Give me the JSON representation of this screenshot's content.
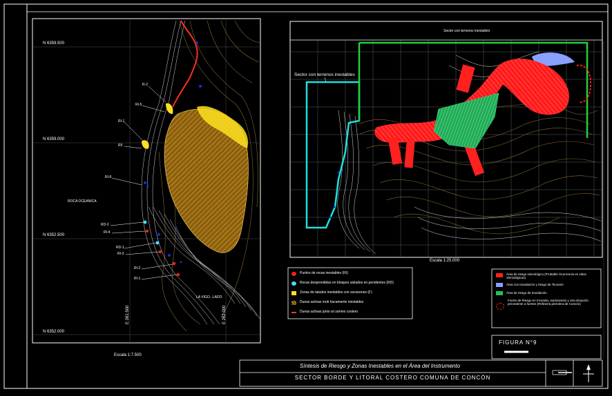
{
  "left_map": {
    "northings": [
      "N 6359.500",
      "N 6359.000",
      "N 6352.500",
      "N 6352.000"
    ],
    "eastings": [
      "E 261.500",
      "E 262.000"
    ],
    "labels": [
      "R-2",
      "RI-5",
      "RI-1",
      "R5",
      "RI-6",
      "ROCA OCEANICA",
      "RD-2",
      "RI-4",
      "RD-1",
      "RI-3",
      "RI-2",
      "RI-1",
      "LA VIGO...LADO"
    ],
    "scale": "Escala 1:7.500"
  },
  "right_map": {
    "top_label": "Sector con terrenos inestables",
    "inestable_label": "Sector con terrenos inestables",
    "scale": "Escala 1:25.000"
  },
  "legend_left": {
    "items": [
      {
        "text": "Puntos de rocas inestables (RI)",
        "color": "#ff2020",
        "shape": "dot"
      },
      {
        "text": "Rocas desprendidas en bloques aislados en pendientes (RD)",
        "color": "#40e0ff",
        "shape": "dot"
      },
      {
        "text": "Zonas de taludes inestables con socavones (F)",
        "color": "#ffe020",
        "shape": "square"
      },
      {
        "text": "Dunas activas moti hacamente inestables",
        "color": "#e0a030",
        "shape": "hatch"
      },
      {
        "text": "Dunas activas junto al camino costero",
        "color": "#ff4020",
        "shape": "line"
      }
    ]
  },
  "legend_right": {
    "items": [
      {
        "text": "Área de riesgo sismológico (Probable Ocurrencia en sitios Sismológicos)",
        "color": "#ff2020",
        "shape": "square"
      },
      {
        "text": "Área con Inundación y riesgo de Tsunami",
        "color": "#8aa0ff",
        "shape": "square"
      },
      {
        "text": "Área de riesgo de Inundación",
        "color": "#20c060",
        "shape": "square"
      },
      {
        "text": "Fuerte de Riesgo en Incendio, explosiones y otra situación precedente a fuertes (Refinería petrolera de Concón)",
        "color": "#ff2020",
        "shape": "ellipse"
      }
    ]
  },
  "figure_label": "FIGURA N°9",
  "title_block": {
    "line1": "Síntesis de Riesgo y Zonas Inestables en el Área del Instrumento",
    "line2": "SECTOR BORDE Y LITORAL COSTERO COMUNA DE CONCÓN"
  },
  "colors": {
    "red": "#ff2020",
    "green": "#20c060",
    "cyan": "#20e0e0",
    "yellow": "#ffe020",
    "contour": "#8a6a3a",
    "blue": "#1a2fd0"
  }
}
